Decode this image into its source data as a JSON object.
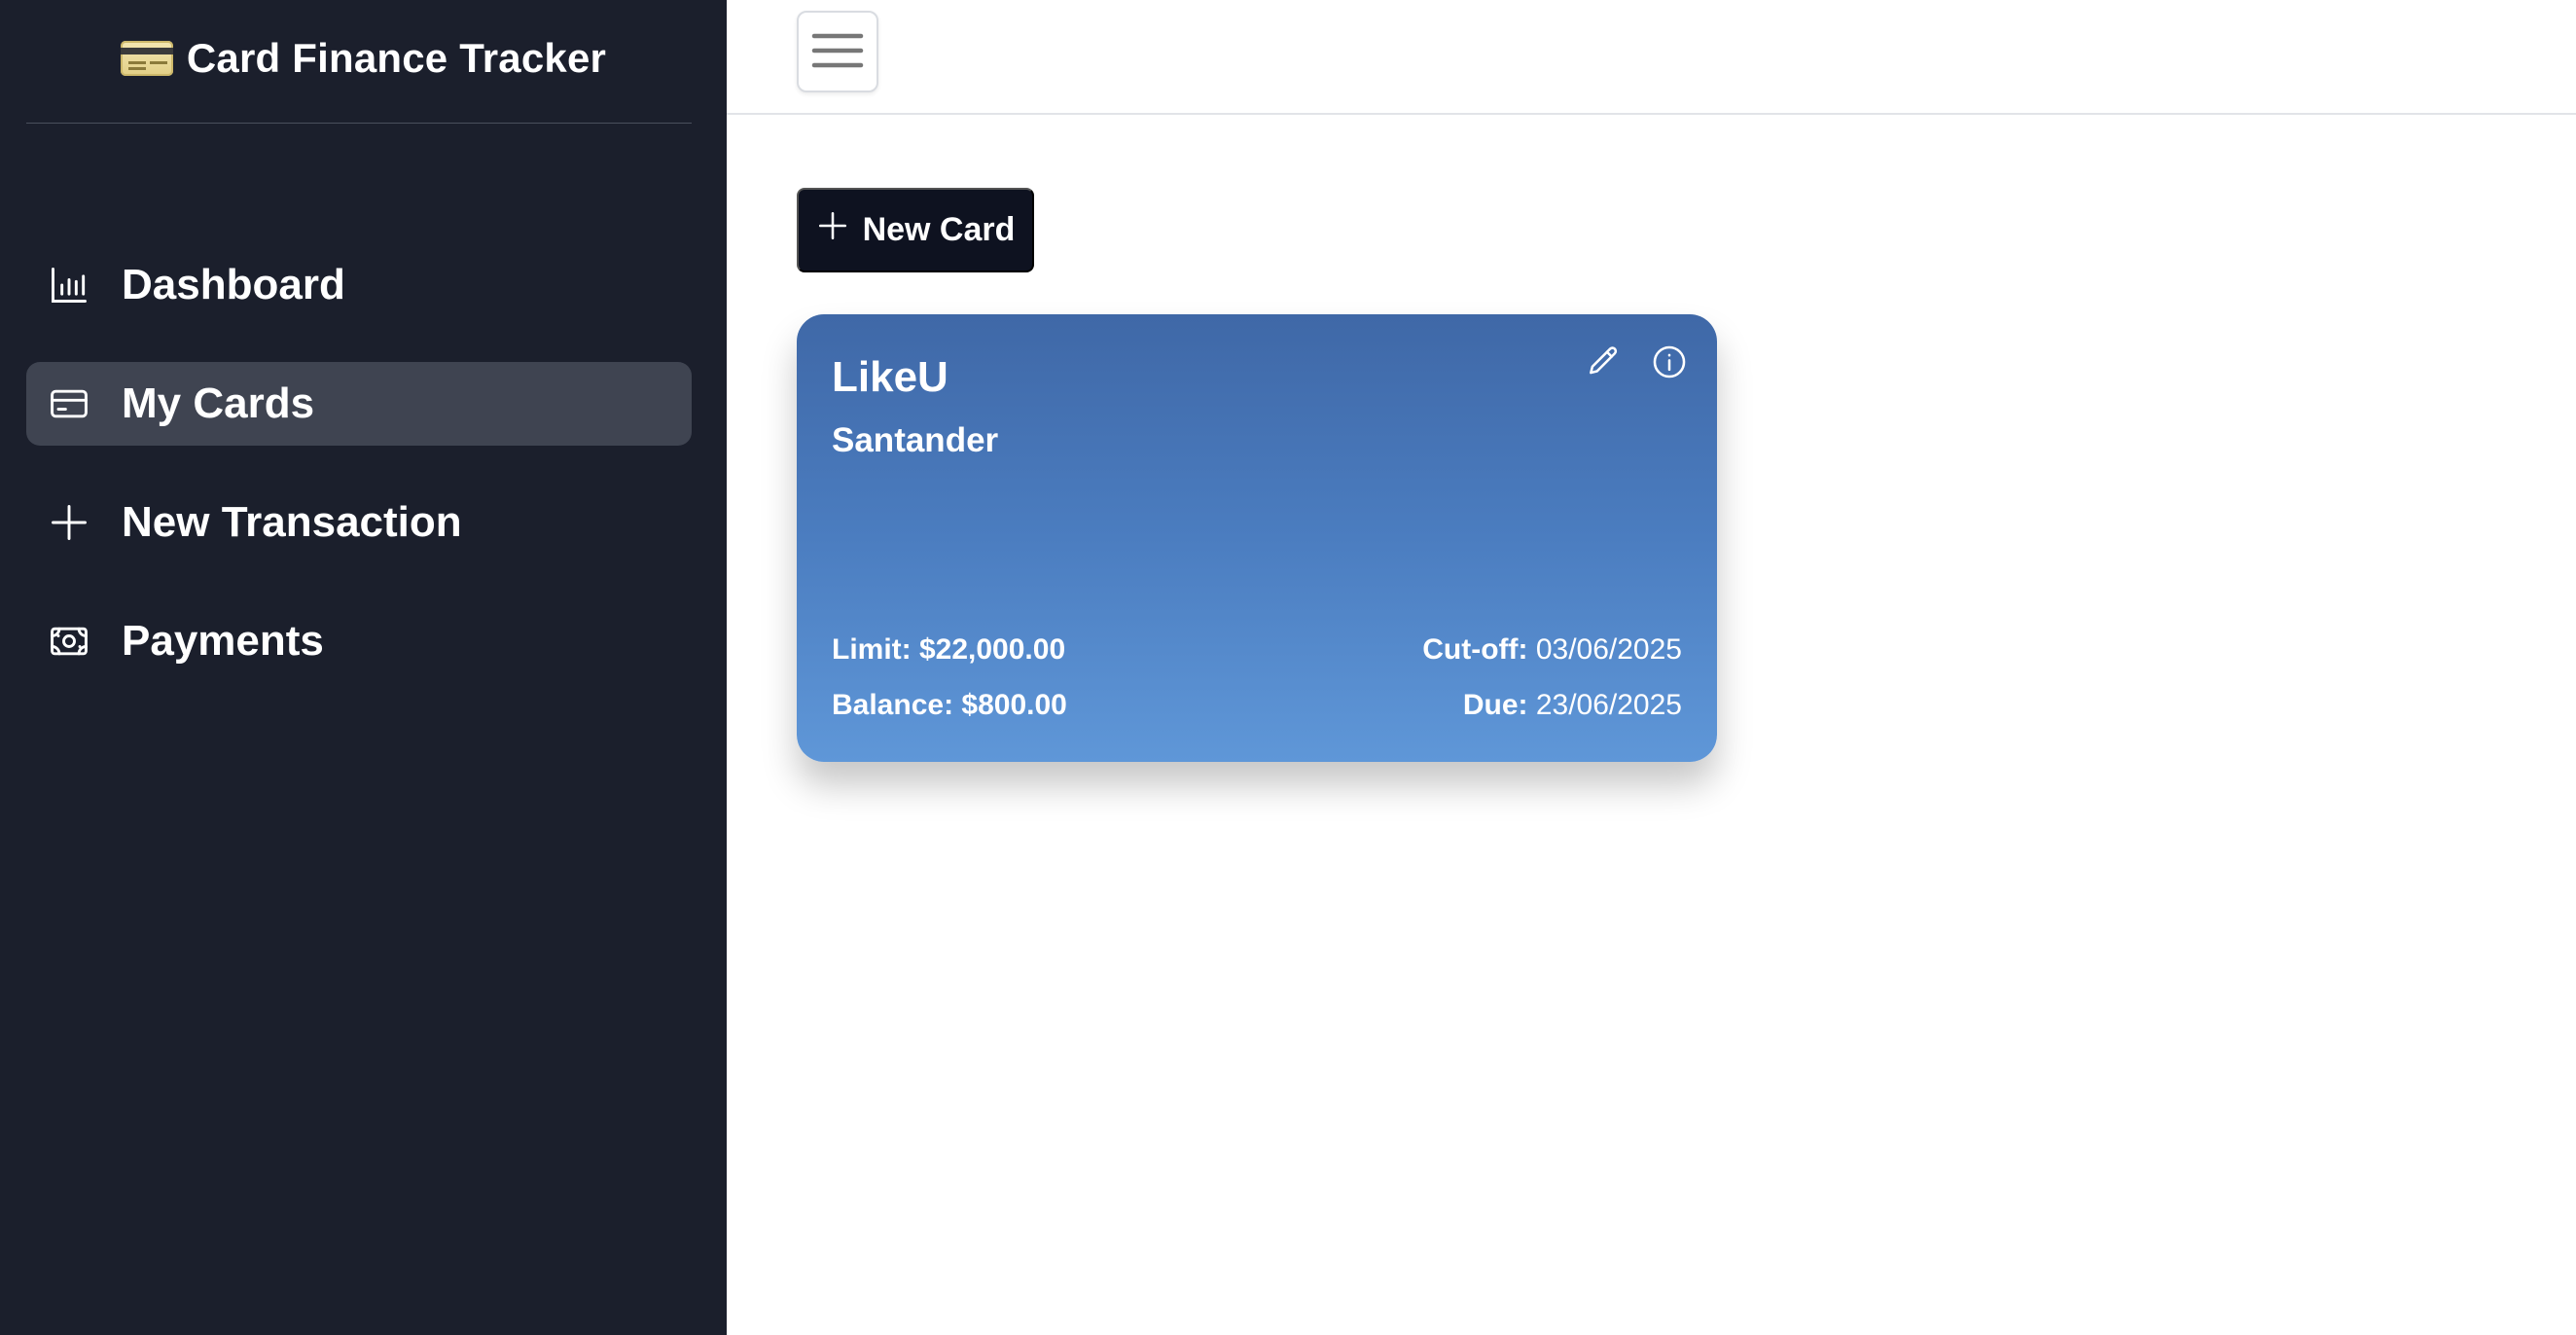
{
  "app": {
    "title": "Card Finance Tracker"
  },
  "sidebar": {
    "items": [
      {
        "label": "Dashboard",
        "icon": "bar-chart-icon",
        "active": false
      },
      {
        "label": "My Cards",
        "icon": "credit-card-icon",
        "active": true
      },
      {
        "label": "New Transaction",
        "icon": "plus-icon",
        "active": false
      },
      {
        "label": "Payments",
        "icon": "banknote-icon",
        "active": false
      }
    ]
  },
  "topbar": {
    "menu_icon": "hamburger-menu-icon"
  },
  "main": {
    "new_card_label": "New Card",
    "cards": [
      {
        "name": "LikeU",
        "bank": "Santander",
        "limit": "Limit: $22,000.00",
        "balance": "Balance: $800.00",
        "cutoff_label": "Cut-off:",
        "cutoff_value": "03/06/2025",
        "due_label": "Due:",
        "due_value": "23/06/2025",
        "gradient": [
          "#3f68a7",
          "#5f97d8"
        ]
      }
    ]
  },
  "colors": {
    "sidebar_bg": "#1b1f2c",
    "active_item_bg": "#3f4451",
    "primary_button": "#0e1220"
  }
}
